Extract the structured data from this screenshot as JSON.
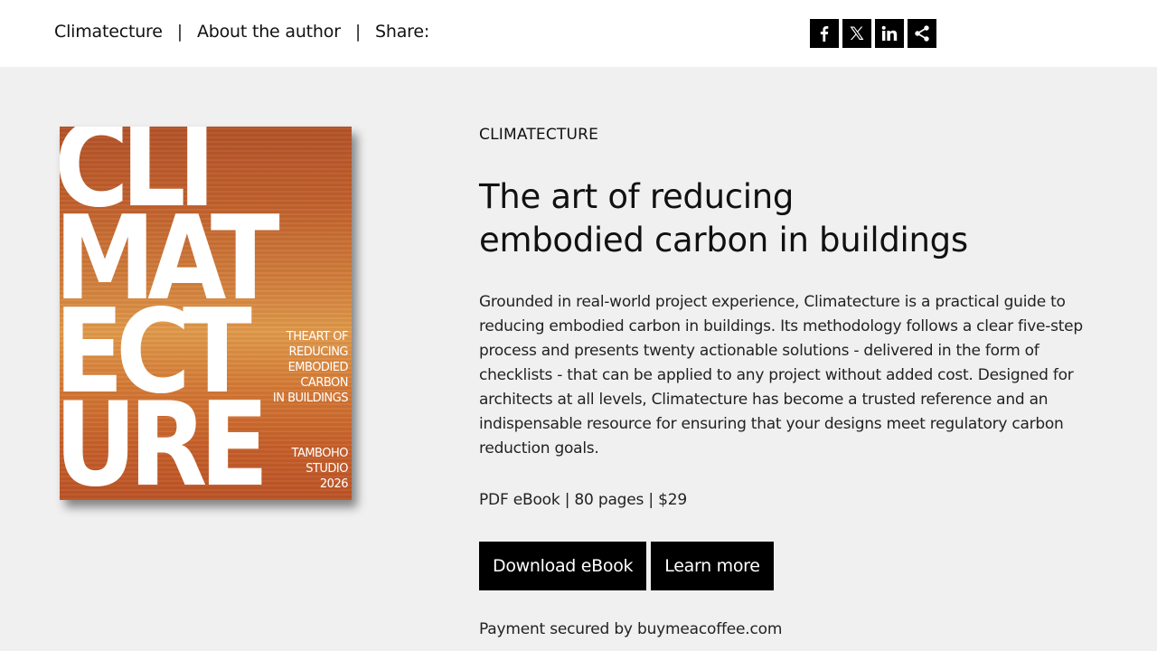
{
  "nav": {
    "home": "Climatecture",
    "sep1": "|",
    "about": "About the author",
    "sep2": "|",
    "share": "Share:"
  },
  "share_icons": [
    "facebook-icon",
    "x-icon",
    "linkedin-icon",
    "share-icon"
  ],
  "book_cover": {
    "big_lines": [
      "CLI",
      "MAT",
      "ECT",
      "URE"
    ],
    "subtitle_lines": [
      "THEART OF",
      "REDUCING",
      "EMBODIED",
      "CARBON",
      "IN BUILDINGS"
    ],
    "studio_lines": [
      "TAMBOHO",
      "STUDIO",
      "2026"
    ]
  },
  "content": {
    "kicker": "CLIMATECTURE",
    "headline_line1": "The art of reducing",
    "headline_line2": "embodied carbon in buildings",
    "description": "Grounded in real-world project experience, Climatecture is a practical guide to reducing embodied carbon in buildings. Its methodology follows a clear five-step process and presents twenty actionable solutions - delivered in the form of checklists - that can be applied to any project without added cost. Designed for architects at all levels, Climatecture has become a trusted reference and an indispensable resource for ensuring that your designs meet regulatory carbon reduction goals.",
    "meta": "PDF eBook | 80 pages | $29",
    "download_label": "Download eBook",
    "learn_label": "Learn more",
    "payment_note": "Payment secured by buymeacoffee.com"
  },
  "colors": {
    "background": "#f0f0f0",
    "topbar": "#ffffff",
    "button": "#000000",
    "cover_orange": "#c8612b"
  }
}
